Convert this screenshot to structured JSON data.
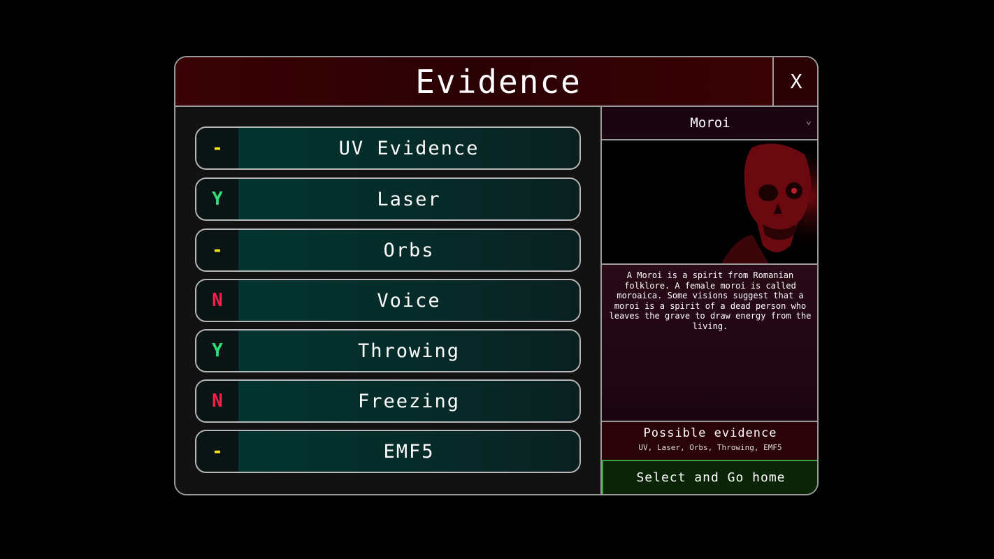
{
  "header": {
    "title": "Evidence",
    "close_label": "X"
  },
  "evidence": [
    {
      "status": "-",
      "status_color": "#f2e21a",
      "label": "UV Evidence"
    },
    {
      "status": "Y",
      "status_color": "#2fe07a",
      "label": "Laser"
    },
    {
      "status": "-",
      "status_color": "#f2e21a",
      "label": "Orbs"
    },
    {
      "status": "N",
      "status_color": "#ff1b4a",
      "label": "Voice"
    },
    {
      "status": "Y",
      "status_color": "#2fe07a",
      "label": "Throwing"
    },
    {
      "status": "N",
      "status_color": "#ff1b4a",
      "label": "Freezing"
    },
    {
      "status": "-",
      "status_color": "#f2e21a",
      "label": "EMF5"
    }
  ],
  "ghost": {
    "selected": "Moroi",
    "description": "A Moroi is a spirit from Romanian folklore. A female moroi is called moroaica. Some visions suggest that a moroi is a spirit of a dead person who leaves the grave to draw energy from the living.",
    "image_icon": "red-skull-ghost-image"
  },
  "possible": {
    "heading": "Possible evidence",
    "list": "UV, Laser, Orbs, Throwing, EMF5"
  },
  "actions": {
    "go_home": "Select and Go home"
  },
  "colors": {
    "accent_red": "#2a0104",
    "accent_teal": "#033530",
    "accent_green": "#3aa23a"
  }
}
